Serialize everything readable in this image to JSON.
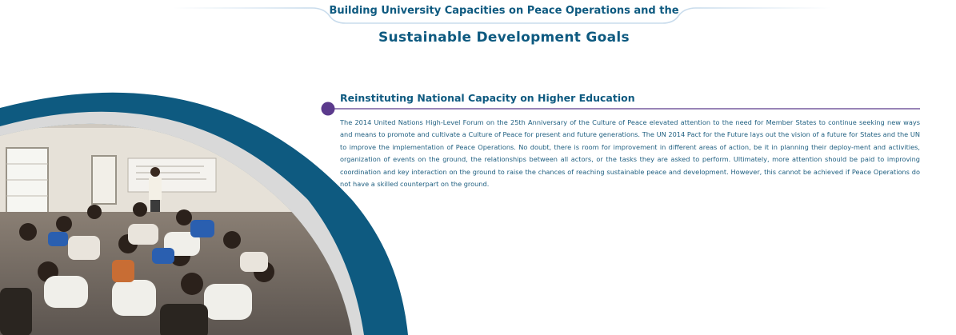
{
  "header": {
    "title_line1": "Building University Capacities on Peace Operations and the",
    "title_line2": "Sustainable Development Goals"
  },
  "section": {
    "title": "Reinstituting National Capacity on Higher Education",
    "body": "The 2014 United Nations High-Level Forum on the 25th Anniversary of the Culture of Peace elevated attention to the need for Member States to continue seeking new ways and means to promote and cultivate a Culture of Peace for present and future generations. The UN 2014 Pact for the Future lays out the vision of a future for States and the UN to improve the implementation of Peace Operations. No doubt, there is room for improvement in different areas of action, be it in planning their deploy-ment and activities, organization of events on the ground, the relationships between all actors, or the tasks they are asked to perform. Ultimately, more attention should be paid to improving coordination and key interaction on the ground to raise the chances of reaching sustainable peace and development. However, this cannot be achieved if Peace Operations do not have a skilled counterpart on the ground."
  },
  "colors": {
    "primary_blue": "#0e5a80",
    "accent_purple": "#5b3a8c",
    "body_text": "#1f5f80"
  }
}
